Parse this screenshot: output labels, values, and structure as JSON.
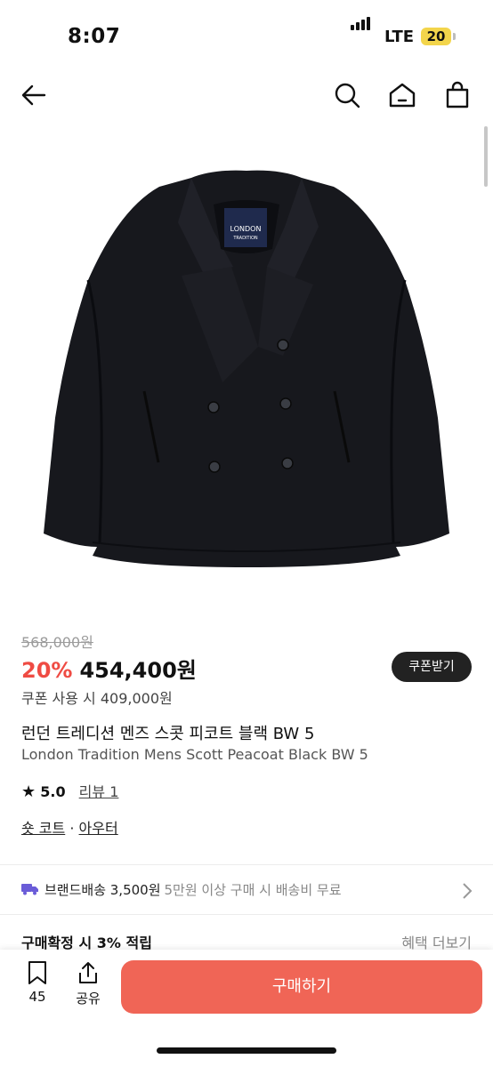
{
  "status_bar": {
    "time": "8:07",
    "network": "LTE",
    "battery": "20"
  },
  "nav": {
    "icons": [
      "back-arrow-icon",
      "search-icon",
      "home-icon",
      "shopping-bag-icon"
    ]
  },
  "product_image": {
    "label_line1": "LONDON",
    "label_line2": "TRADITION"
  },
  "price": {
    "original": "568,000원",
    "discount": "20%",
    "sale": "454,400원",
    "coupon_button": "쿠폰받기",
    "coupon_note": "쿠폰 사용 시 409,000원"
  },
  "title": {
    "ko": "런던 트레디션 멘즈 스콧 피코트 블랙 BW 5",
    "en": "London Tradition Mens Scott Peacoat Black BW 5"
  },
  "rating": {
    "score": "5.0",
    "review_link": "리뷰 1"
  },
  "categories": {
    "first": "숏 코트",
    "sep": "·",
    "second": "아우터"
  },
  "shipping": {
    "label": "브랜드배송 3,500원",
    "note": "5만원 이상 구매 시 배송비 무료"
  },
  "points": {
    "label": "구매확정 시 3% 적립",
    "more": "혜택 더보기"
  },
  "bottom_bar": {
    "bookmark_count": "45",
    "share_label": "공유",
    "buy_label": "구매하기"
  },
  "colors": {
    "accent": "#f06556",
    "discount": "#ef4b43",
    "dark": "#222222"
  }
}
